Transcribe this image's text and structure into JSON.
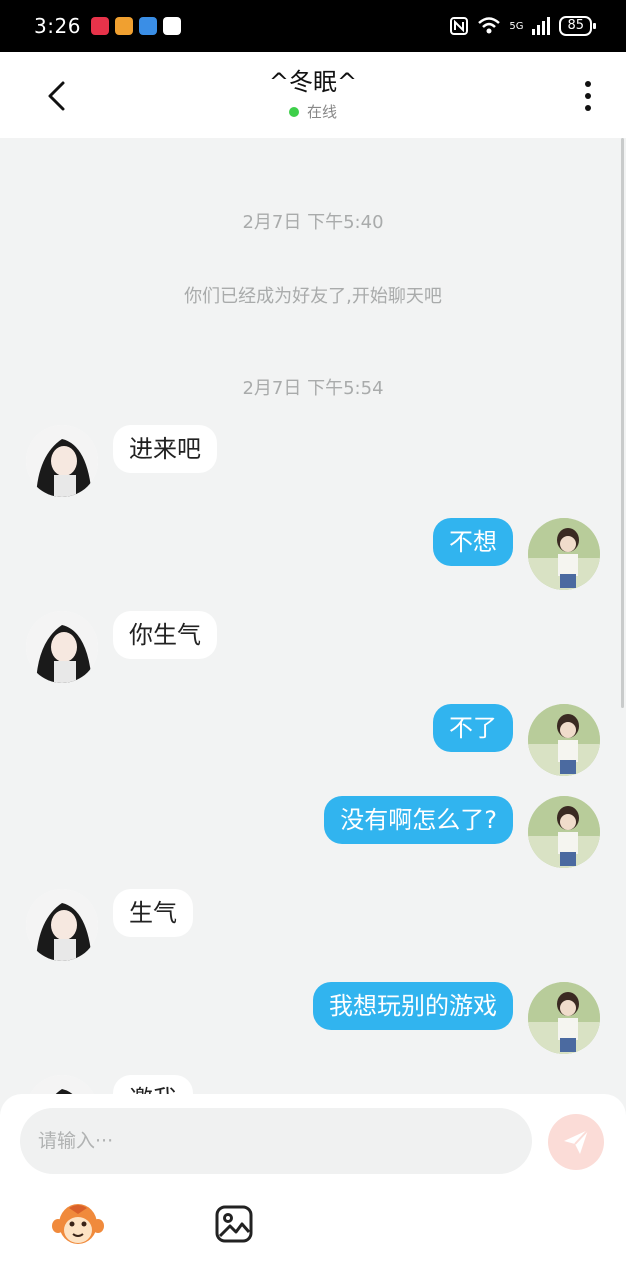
{
  "status_bar": {
    "time": "3:26",
    "battery": "85",
    "network": "5G"
  },
  "header": {
    "title": "^冬眠^",
    "online_status": "在线"
  },
  "messages": [
    {
      "kind": "time",
      "text": "2月7日 下午5:40"
    },
    {
      "kind": "system",
      "text": "你们已经成为好友了,开始聊天吧"
    },
    {
      "kind": "time",
      "text": "2月7日 下午5:54"
    },
    {
      "kind": "in",
      "text": "进来吧"
    },
    {
      "kind": "out",
      "text": "不想"
    },
    {
      "kind": "in",
      "text": "你生气"
    },
    {
      "kind": "out",
      "text": "不了"
    },
    {
      "kind": "out",
      "text": "没有啊怎么了?"
    },
    {
      "kind": "in",
      "text": "生气"
    },
    {
      "kind": "out",
      "text": "我想玩别的游戏"
    },
    {
      "kind": "in",
      "text": "邀我"
    }
  ],
  "composer": {
    "placeholder": "请输入···",
    "value": ""
  },
  "colors": {
    "outgoing_bubble": "#31b4ef",
    "incoming_bubble": "#ffffff",
    "online_dot": "#3ecf4a",
    "send_button": "#fbdcd7"
  },
  "icons": {
    "back": "chevron-left-icon",
    "more": "more-vertical-icon",
    "send": "paper-plane-icon",
    "sticker": "monkey-sticker-icon",
    "image": "image-icon"
  }
}
